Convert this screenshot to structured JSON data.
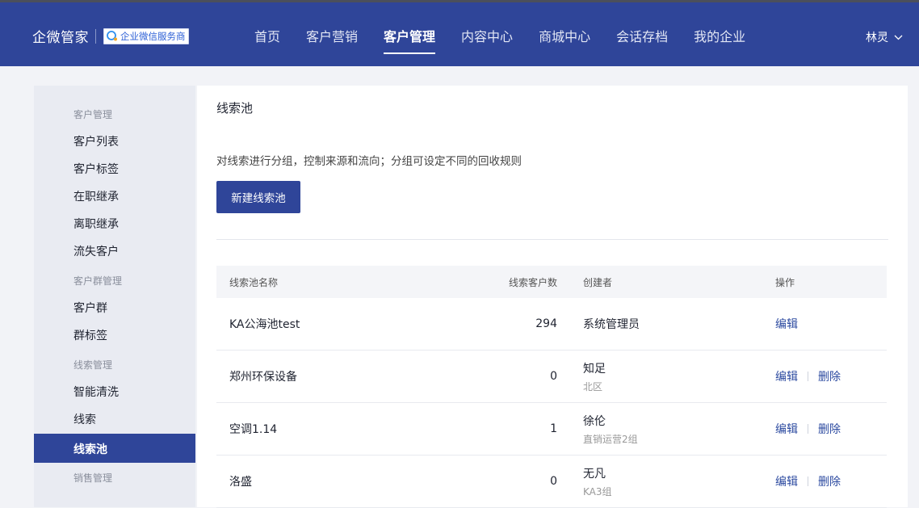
{
  "header": {
    "brand": "企微管家",
    "badge_text": "企业微信服务商",
    "nav": [
      {
        "label": "首页",
        "active": false
      },
      {
        "label": "客户营销",
        "active": false
      },
      {
        "label": "客户管理",
        "active": true
      },
      {
        "label": "内容中心",
        "active": false
      },
      {
        "label": "商城中心",
        "active": false
      },
      {
        "label": "会话存档",
        "active": false
      },
      {
        "label": "我的企业",
        "active": false
      }
    ],
    "user_name": "林灵"
  },
  "sidebar": {
    "groups": [
      {
        "title": "客户管理",
        "items": [
          {
            "label": "客户列表"
          },
          {
            "label": "客户标签"
          },
          {
            "label": "在职继承"
          },
          {
            "label": "离职继承"
          },
          {
            "label": "流失客户"
          }
        ]
      },
      {
        "title": "客户群管理",
        "items": [
          {
            "label": "客户群"
          },
          {
            "label": "群标签"
          }
        ]
      },
      {
        "title": "线索管理",
        "items": [
          {
            "label": "智能清洗"
          },
          {
            "label": "线索"
          },
          {
            "label": "线索池",
            "active": true
          }
        ]
      },
      {
        "title": "销售管理",
        "items": []
      }
    ]
  },
  "main": {
    "title": "线索池",
    "description": "对线索进行分组，控制来源和流向；分组可设定不同的回收规则",
    "new_button": "新建线索池",
    "table": {
      "headers": [
        "线索池名称",
        "线索客户数",
        "创建者",
        "操作"
      ],
      "rows": [
        {
          "name": "KA公海池test",
          "count": "294",
          "creator": "系统管理员",
          "dept": "",
          "edit": "编辑",
          "delete": ""
        },
        {
          "name": "郑州环保设备",
          "count": "0",
          "creator": "知足",
          "dept": "北区",
          "edit": "编辑",
          "delete": "删除"
        },
        {
          "name": "空调1.14",
          "count": "1",
          "creator": "徐伦",
          "dept": "直销运营2组",
          "edit": "编辑",
          "delete": "删除"
        },
        {
          "name": "洛盛",
          "count": "0",
          "creator": "无凡",
          "dept": "KA3组",
          "edit": "编辑",
          "delete": "删除"
        }
      ]
    }
  },
  "colors": {
    "primary": "#2f4599",
    "link": "#2c4aa0",
    "background": "#f2f3f7"
  }
}
